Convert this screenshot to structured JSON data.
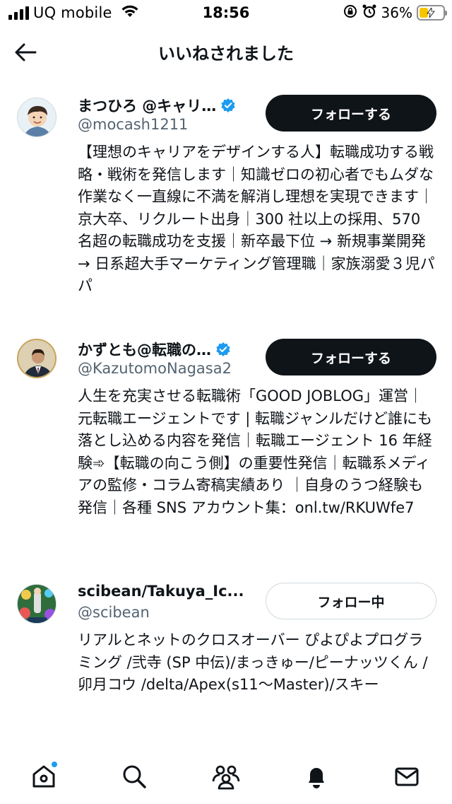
{
  "status_bar": {
    "carrier": "UQ mobile",
    "time": "18:56",
    "battery_percent": "36%",
    "battery_level": 0.36
  },
  "header": {
    "title": "いいねされました"
  },
  "users": [
    {
      "name": "まつひろ @キャリ…",
      "handle": "@mocash1211",
      "verified": true,
      "follow_label": "フォローする",
      "bio": "【理想のキャリアをデザインする人】転職成功する戦略・戦術を発信します｜知識ゼロの初心者でもムダな作業なく一直線に不満を解消し理想を実現できます｜京大卒、リクルート出身｜300 社以上の採用、570 名超の転職成功を支援｜新卒最下位 → 新規事業開発 → 日系超大手マーケティング管理職｜家族溺愛３児パパ"
    },
    {
      "name": "かずとも@転職の…",
      "handle": "@KazutomoNagasa2",
      "verified": true,
      "follow_label": "フォローする",
      "bio": "人生を充実させる転職術「GOOD JOBLOG」運営｜元転職エージェントです | 転職ジャンルだけど誰にも落とし込める内容を発信｜転職エージェント 16 年経験➾【転職の向こう側】の重要性発信｜転職系メディアの監修・コラム寄稿実績あり ｜自身のうつ経験も発信｜各種 SNS アカウント集：onl.tw/RKUWfe7"
    },
    {
      "name": "scibean/Takuya_Ic...",
      "handle": "@scibean",
      "verified": false,
      "follow_label": "フォロー中",
      "bio": "リアルとネットのクロスオーバー ぴよぴよプログラミング /弐寺 (SP 中伝)/まっきゅー/ピーナッツくん /卯月コウ /delta/Apex(s11～Master)/スキー"
    }
  ],
  "tabbar": {
    "items": [
      "home-icon",
      "search-icon",
      "communities-icon",
      "notifications-icon",
      "messages-icon"
    ]
  },
  "colors": {
    "text": "#0f1419",
    "secondary": "#536471",
    "verified": "#1d9bf0",
    "battery": "#f7c500"
  }
}
